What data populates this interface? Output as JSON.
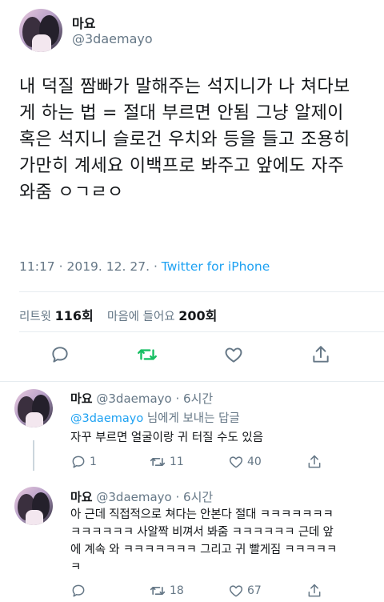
{
  "main_tweet": {
    "display_name": "마요",
    "handle": "@3daemayo",
    "text_lines": [
      "내 덕질 짬빠가 말해주는 석지니가 나 쳐다보",
      "게 하는 법 = 절대 부르면 안됨 그냥 알제이",
      "혹은 석지니 슬로건 우치와 등을 들고 조용히",
      "가만히 계세요 이백프로 봐주고 앞에도 자주",
      "와줌 ㅇㄱㄹㅇ"
    ],
    "time": "11:17",
    "date": "2019. 12. 27.",
    "source": "Twitter for iPhone",
    "retweet_label": "리트윗",
    "retweet_count": "116회",
    "like_label": "마음에 들어요",
    "like_count": "200회"
  },
  "replies": [
    {
      "display_name": "마요",
      "handle": "@3daemayo",
      "age": "6시간",
      "replying_mention": "@3daemayo",
      "replying_suffix": "님에게 보내는 답글",
      "text_lines": [
        "자꾸 부르면 얼굴이랑 귀 터질 수도 있음"
      ],
      "reply_count": "1",
      "retweet_count": "11",
      "like_count": "40"
    },
    {
      "display_name": "마요",
      "handle": "@3daemayo",
      "age": "6시간",
      "text_lines": [
        "아 근데 직접적으로 쳐다는 안본다 절대 ㅋㅋㅋㅋㅋㅋㅋ",
        "ㅋㅋㅋㅋㅋㅋ 사알짝 비껴서 봐줌 ㅋㅋㅋㅋㅋㅋ 근데 앞",
        "에 계속 와 ㅋㅋㅋㅋㅋㅋㅋ 그리고 귀 빨게짐 ㅋㅋㅋㅋㅋ",
        "ㅋ"
      ],
      "retweet_count": "18",
      "like_count": "67"
    }
  ],
  "colors": {
    "accent": "#1da1f2",
    "retweet_green": "#17bf63",
    "muted": "#657786"
  },
  "icons": [
    "reply-icon",
    "retweet-icon",
    "like-icon",
    "share-icon"
  ]
}
